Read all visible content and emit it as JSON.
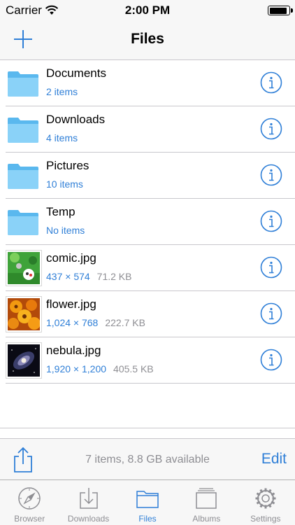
{
  "status_bar": {
    "carrier": "Carrier",
    "time": "2:00 PM",
    "battery_level": 0.95
  },
  "nav": {
    "title": "Files",
    "add_icon": "plus-icon"
  },
  "files": [
    {
      "name": "Documents",
      "detail": "2 items",
      "size": "",
      "kind": "folder",
      "icon": "folder-icon"
    },
    {
      "name": "Downloads",
      "detail": "4 items",
      "size": "",
      "kind": "folder",
      "icon": "folder-icon"
    },
    {
      "name": "Pictures",
      "detail": "10 items",
      "size": "",
      "kind": "folder",
      "icon": "folder-icon"
    },
    {
      "name": "Temp",
      "detail": "No items",
      "size": "",
      "kind": "folder",
      "icon": "folder-icon"
    },
    {
      "name": "comic.jpg",
      "detail": "437 × 574",
      "size": "71.2 KB",
      "kind": "image",
      "icon": "comic-thumbnail"
    },
    {
      "name": "flower.jpg",
      "detail": "1,024 × 768",
      "size": "222.7 KB",
      "kind": "image",
      "icon": "flower-thumbnail"
    },
    {
      "name": "nebula.jpg",
      "detail": "1,920 × 1,200",
      "size": "405.5 KB",
      "kind": "image",
      "icon": "nebula-thumbnail"
    }
  ],
  "toolbar": {
    "share_icon": "share-icon",
    "storage_text": "7 items, 8.8 GB available",
    "edit_label": "Edit"
  },
  "tabs": [
    {
      "label": "Browser",
      "icon": "compass-icon",
      "active": false
    },
    {
      "label": "Downloads",
      "icon": "download-tray-icon",
      "active": false
    },
    {
      "label": "Files",
      "icon": "folder-icon",
      "active": true
    },
    {
      "label": "Albums",
      "icon": "albums-icon",
      "active": false
    },
    {
      "label": "Settings",
      "icon": "gear-icon",
      "active": false
    }
  ],
  "colors": {
    "accent": "#2f7fd7",
    "secondary_text": "#8e8e93",
    "folder": "#6cc3f5",
    "bar_background": "#f7f7f7"
  }
}
